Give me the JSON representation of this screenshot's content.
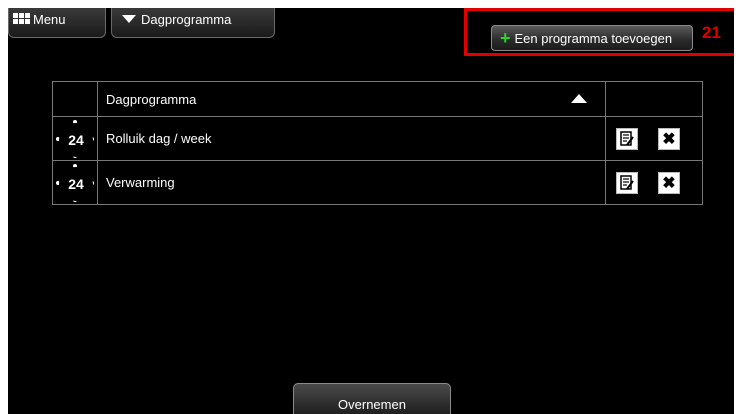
{
  "topbar": {
    "menu_label": "Menu",
    "dropdown_label": "Dagprogramma"
  },
  "add_button": {
    "label": "Een programma toevoegen"
  },
  "annotation": {
    "label": "21",
    "color": "#e00000"
  },
  "table": {
    "header": "Dagprogramma",
    "rows": [
      {
        "icon_text": "24",
        "name": "Rolluik dag / week"
      },
      {
        "icon_text": "24",
        "name": "Verwarming"
      }
    ]
  },
  "footer": {
    "apply_label": "Overnemen"
  },
  "colors": {
    "background": "#000000",
    "accent_plus": "#2bd62b",
    "highlight": "#e00000"
  }
}
